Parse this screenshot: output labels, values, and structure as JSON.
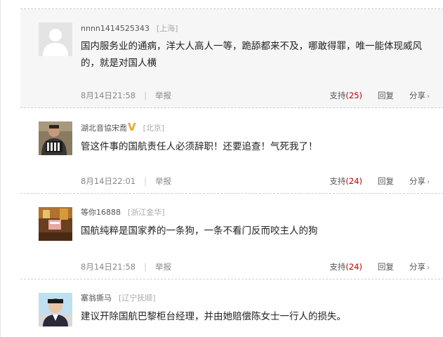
{
  "comments": [
    {
      "username": "nnnn1414525343",
      "location": "[上海]",
      "text": "国内服务业的通病，洋大人高人一等，跪舔都来不及，哪敢得罪，唯一能体现威风的，就是对国人横",
      "time": "8月14日21:58",
      "report": "举报",
      "support_label": "支持",
      "support_count": "(25)",
      "reply": "回复",
      "share": "分享",
      "avatar": "default-avatar"
    },
    {
      "username": "湖北音協宋喬",
      "verified": "V",
      "location": "[北京]",
      "text": "管这件事的国航责任人必须辞职！还要追查！气死我了！",
      "time": "8月14日22:01",
      "report": "举报",
      "support_label": "支持",
      "support_count": "(24)",
      "reply": "回复",
      "share": "分享",
      "avatar": "accordion-player-photo"
    },
    {
      "username": "等你16888",
      "location": "[浙江金华]",
      "text": "国航纯粹是国家养的一条狗，一条不看门反而咬主人的狗",
      "time": "8月14日21:58",
      "report": "举报",
      "support_label": "支持",
      "support_count": "(24)",
      "reply": "回复",
      "share": "分享",
      "avatar": "interior-photo"
    },
    {
      "username": "塞翁撕马",
      "location": "[辽宁抚顺]",
      "text": "建议开除国航巴黎柜台经理，并由她赔偿陈女士一行人的损失。",
      "avatar": "portrait-photo"
    }
  ],
  "colors": {
    "support_count": "#c00000",
    "verified_badge": "#f2a51e",
    "highlight_bg": "#f6f6f6"
  },
  "icons": {
    "share_chevron": "›"
  }
}
